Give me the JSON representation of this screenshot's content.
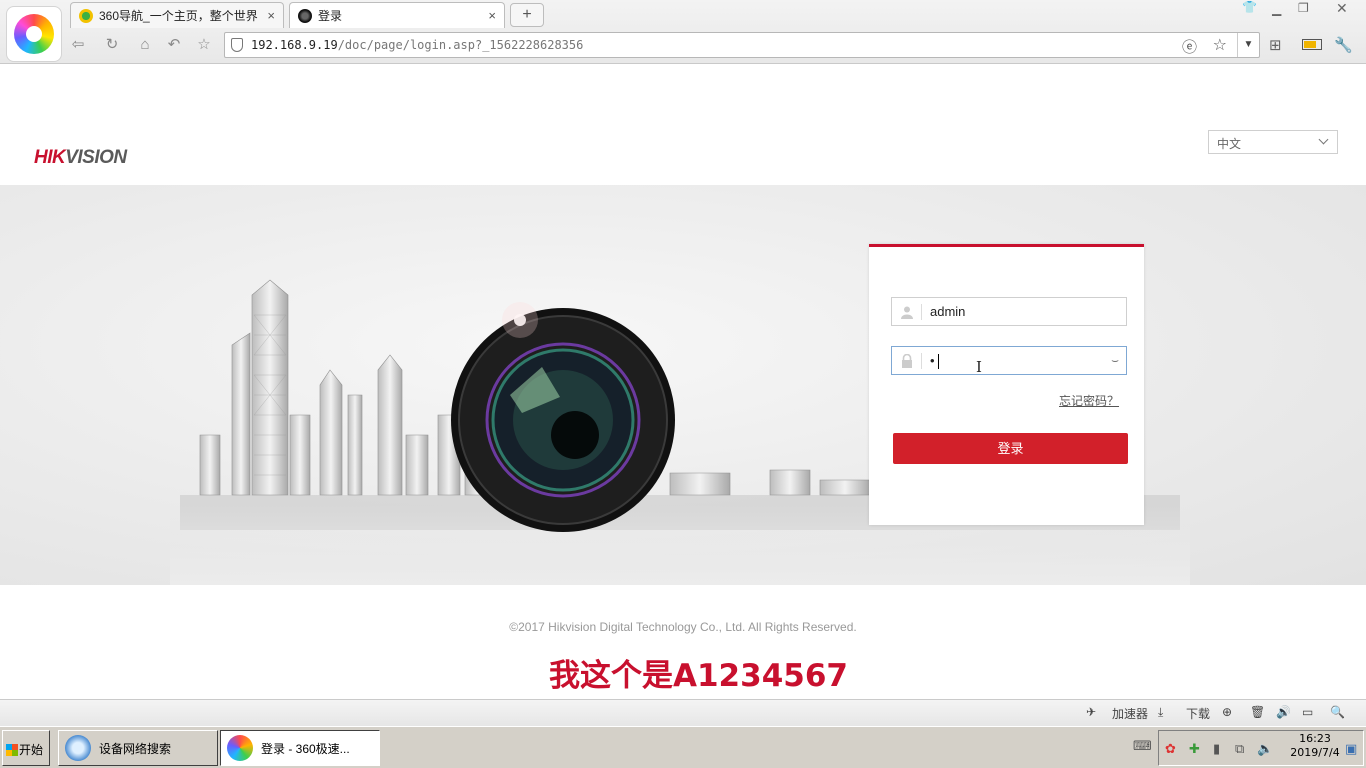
{
  "browser": {
    "tabs": [
      {
        "title": "360导航_一个主页，整个世界",
        "close": "×",
        "active": false
      },
      {
        "title": "登录",
        "close": "×",
        "active": true
      }
    ],
    "new_tab": "+",
    "address": {
      "host": "192.168.9.19",
      "path": "/doc/page/login.asp?_1562228628356"
    },
    "icons": [
      "back-icon",
      "refresh-icon",
      "home-icon",
      "undo-icon",
      "favorite-icon",
      "shield-icon",
      "ie-mode-icon",
      "star-icon",
      "dropdown-icon",
      "extensions-icon",
      "battery-icon",
      "tools-icon"
    ]
  },
  "page": {
    "logo": {
      "hik": "HIK",
      "vision": "VISION"
    },
    "language": "中文",
    "login": {
      "username": "admin",
      "password_mask": "•",
      "eye": "⌣",
      "forgot": "忘记密码？",
      "submit": "登录"
    },
    "copyright": "©2017 Hikvision Digital Technology Co., Ltd. All Rights Reserved.",
    "annotation": "我这个是A1234567"
  },
  "statusbar": {
    "accelerator": "加速器",
    "download": "下载"
  },
  "taskbar": {
    "start": "开始",
    "tasks": [
      {
        "label": "设备网络搜索",
        "active": false
      },
      {
        "label": "登录 - 360极速...",
        "active": true
      }
    ],
    "clock": {
      "time": "16:23",
      "date": "2019/7/4"
    }
  },
  "colors": {
    "brand": "#c8102e",
    "button": "#d2202a"
  }
}
